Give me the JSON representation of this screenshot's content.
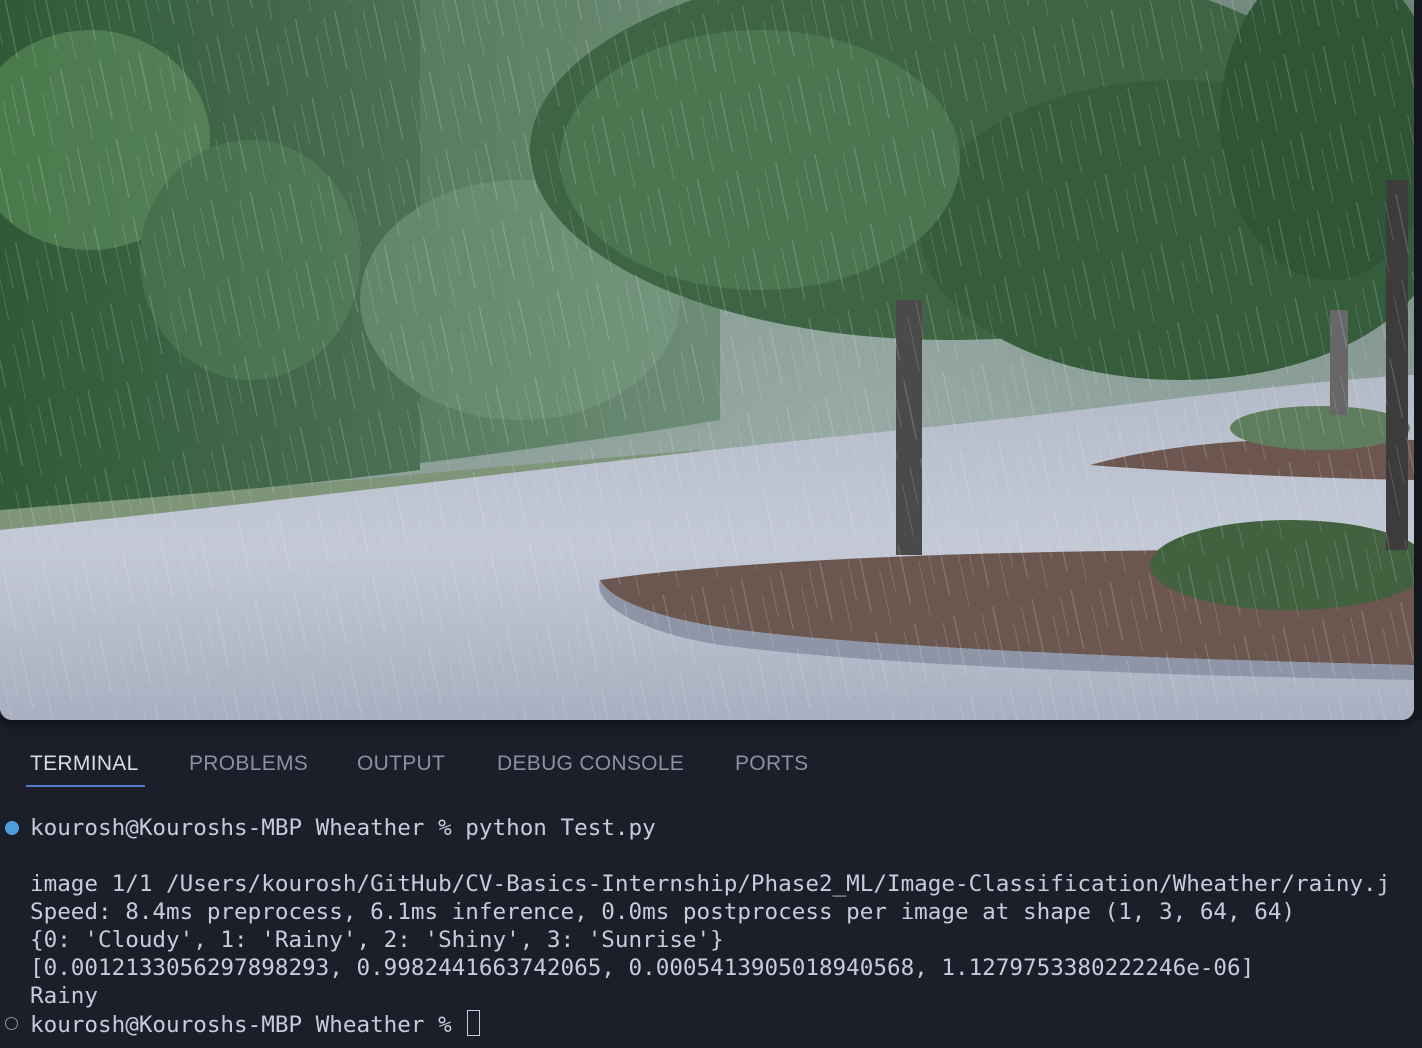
{
  "preview": {
    "alt_subject": "rainy"
  },
  "panel": {
    "tabs": [
      {
        "label": "TERMINAL",
        "active": true
      },
      {
        "label": "PROBLEMS",
        "active": false
      },
      {
        "label": "OUTPUT",
        "active": false
      },
      {
        "label": "DEBUG CONSOLE",
        "active": false
      },
      {
        "label": "PORTS",
        "active": false
      }
    ],
    "accent_color": "#5a77d0"
  },
  "terminal": {
    "command_line": {
      "prompt": "kourosh@Kouroshs-MBP Wheather % ",
      "command": "python Test.py",
      "status_color": "#4a9fd8"
    },
    "output": [
      "image 1/1 /Users/kourosh/GitHub/CV-Basics-Internship/Phase2_ML/Image-Classification/Wheather/rainy.j",
      "Speed: 8.4ms preprocess, 6.1ms inference, 0.0ms postprocess per image at shape (1, 3, 64, 64)",
      "{0: 'Cloudy', 1: 'Rainy', 2: 'Shiny', 3: 'Sunrise'}",
      "[0.0012133056297898293, 0.9982441663742065, 0.0005413905018940568, 1.1279753380222246e-06]",
      "Rainy"
    ],
    "current_prompt": "kourosh@Kouroshs-MBP Wheather % "
  }
}
